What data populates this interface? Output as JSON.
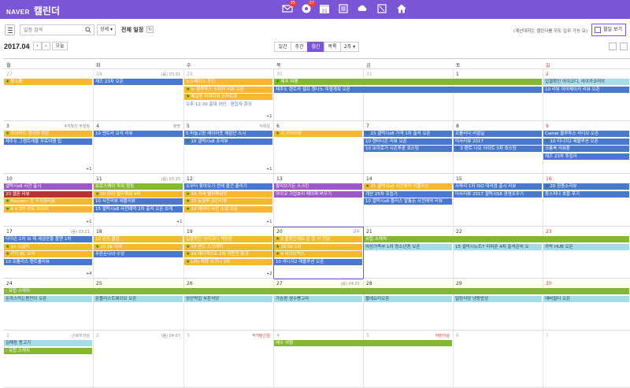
{
  "header": {
    "brand": "NAVER",
    "title": "캘린더",
    "icons": [
      {
        "name": "mail-icon",
        "badge": "25"
      },
      {
        "name": "talk-icon",
        "badge": "27"
      },
      {
        "name": "calendar-icon",
        "badge": "31"
      },
      {
        "name": "contacts-icon"
      },
      {
        "name": "cloud-icon"
      },
      {
        "name": "memo-icon"
      },
      {
        "name": "home-icon"
      }
    ]
  },
  "toolbar": {
    "search_placeholder": "일정 검색",
    "detail_label": "상세 ▾",
    "all_label": "전체 일정",
    "refresh_icon": "↻",
    "notice": "(계산대하는 캘린더를 자도 입무 가능 요)",
    "monthly_label": "월일 보기"
  },
  "nav": {
    "month": "2017.04",
    "prev": "‹",
    "next": "›",
    "today": "오늘",
    "view_tabs": [
      "일간",
      "주간",
      "월간",
      "목록",
      "2주 ▾"
    ],
    "active_view": "월간"
  },
  "weekdays": [
    "월",
    "화",
    "수",
    "목",
    "금",
    "토",
    "일"
  ],
  "weeks": [
    {
      "days": [
        {
          "num": "27",
          "muted": true
        },
        {
          "num": "28",
          "muted": true,
          "label": "(음) 03.01"
        },
        {
          "num": "29",
          "muted": true
        },
        {
          "num": "30",
          "muted": true
        },
        {
          "num": "31",
          "muted": true
        },
        {
          "num": "1"
        },
        {
          "num": "2",
          "sun": true
        }
      ],
      "events": [
        {
          "col": 0,
          "span": 1,
          "row": 0,
          "color": "y",
          "star": true,
          "text": "봄소풍"
        },
        {
          "col": 1,
          "span": 1,
          "row": 0,
          "color": "b",
          "text": "재즈 23차 오픈"
        },
        {
          "col": 2,
          "span": 1,
          "row": 0,
          "color": "y",
          "text": "노스페이스 조인"
        },
        {
          "col": 3,
          "span": 3,
          "row": 0,
          "color": "g",
          "star": true,
          "text": "제주 여행"
        },
        {
          "col": 6,
          "span": 1,
          "row": 0,
          "color": "c",
          "text": "입결확인 아이코디, 라이카코리아"
        },
        {
          "col": 2,
          "span": 1,
          "row": 1,
          "color": "y",
          "star": true,
          "text": "뉴 블루투스 스피커 리뷰 오픈"
        },
        {
          "col": 3,
          "span": 3,
          "row": 1,
          "color": "b",
          "text": "제주도 렌트카 셀프 렌나노 여행계획 오픈"
        },
        {
          "col": 6,
          "span": 1,
          "row": 1,
          "color": "b",
          "text": "10 리뷰 아이메이커 리뷰 오픈"
        },
        {
          "col": 2,
          "span": 1,
          "row": 2,
          "color": "y",
          "star": true,
          "text": "메일동 아이디어 스마트폰"
        },
        {
          "col": 2,
          "span": 1,
          "row": 3,
          "color": "text",
          "text": "오후 12:30 홍대 와인 · 편집자 회의"
        }
      ],
      "more": [
        {
          "col": 2,
          "text": "+1"
        }
      ]
    },
    {
      "days": [
        {
          "num": "3"
        },
        {
          "num": "4",
          "label": "청명"
        },
        {
          "num": "5",
          "label": "식목일"
        },
        {
          "num": "6"
        },
        {
          "num": "7"
        },
        {
          "num": "8"
        },
        {
          "num": "9",
          "sun": true
        }
      ],
      "day_labels_extra": [
        {
          "col": 0,
          "text": "4개월간 주설정"
        }
      ],
      "events": [
        {
          "col": 0,
          "span": 1,
          "row": 0,
          "color": "y",
          "star": true,
          "text": "하이마트 영상장 방문"
        },
        {
          "col": 1,
          "span": 1,
          "row": 0,
          "color": "b",
          "text": "10 엔트리 오리 리뷰"
        },
        {
          "col": 2,
          "span": 1,
          "row": 0,
          "color": "b",
          "text": "5 마늘고등 레이아웃 체험단 스시"
        },
        {
          "col": 3,
          "span": 1,
          "row": 0,
          "color": "y",
          "star": true,
          "text": "오 카이아몬"
        },
        {
          "col": 4,
          "span": 1,
          "row": 0,
          "color": "b",
          "star": true,
          "text": "15 갤럭시s8 가격 1차 출석 오픈"
        },
        {
          "col": 5,
          "span": 1,
          "row": 0,
          "color": "b",
          "text": "프롤리다 리얼딜"
        },
        {
          "col": 6,
          "span": 1,
          "row": 0,
          "color": "b",
          "text": "Camel 블루투스 라디오 오픈"
        },
        {
          "col": 0,
          "span": 1,
          "row": 1,
          "color": "b",
          "text": "제주도 그램트래블 무료여행 팁"
        },
        {
          "col": 2,
          "span": 1,
          "row": 1,
          "color": "b",
          "star": true,
          "text": "10 갤럭시s8 조리뷰"
        },
        {
          "col": 4,
          "span": 1,
          "row": 1,
          "color": "b",
          "text": "10 렌터나은 리뷰 오픈"
        },
        {
          "col": 5,
          "span": 1,
          "row": 1,
          "color": "b",
          "text": "미사리뷰 2017"
        },
        {
          "col": 6,
          "span": 1,
          "row": 1,
          "color": "b",
          "star": true,
          "text": "10 리니지2 레볼루션 오픈"
        },
        {
          "col": 4,
          "span": 1,
          "row": 2,
          "color": "b",
          "text": "10 보이로거 시즌투중 호스팅"
        },
        {
          "col": 5,
          "span": 1,
          "row": 2,
          "color": "b",
          "star": true,
          "text": "3 렌트 나오 사이트 3차 호스팅"
        },
        {
          "col": 6,
          "span": 1,
          "row": 2,
          "color": "b",
          "text": "크롬북 리뷰툰"
        },
        {
          "col": 6,
          "span": 1,
          "row": 3,
          "color": "b",
          "text": "재즈 23차 휴집리"
        }
      ],
      "more": [
        {
          "col": 0,
          "text": "+1"
        },
        {
          "col": 2,
          "text": "+1"
        }
      ]
    },
    {
      "days": [
        {
          "num": "10"
        },
        {
          "num": "11",
          "label": "(음) 03.15"
        },
        {
          "num": "12"
        },
        {
          "num": "13"
        },
        {
          "num": "14"
        },
        {
          "num": "15"
        },
        {
          "num": "16",
          "sun": true
        }
      ],
      "events": [
        {
          "col": 0,
          "span": 1,
          "row": 0,
          "color": "p",
          "text": "갤럭시s8 사전 출시"
        },
        {
          "col": 1,
          "span": 1,
          "row": 0,
          "color": "g",
          "text": "유로스퀘어 파워 캠핑"
        },
        {
          "col": 2,
          "span": 1,
          "row": 0,
          "color": "b",
          "text": "소무터 찾아오기 전에 물건 흘리기"
        },
        {
          "col": 3,
          "span": 1,
          "row": 0,
          "color": "p",
          "text": "할리브가든 스크린"
        },
        {
          "col": 4,
          "span": 1,
          "row": 0,
          "color": "y",
          "star": true,
          "text": "15 갤럭시s8 사전예약 어플리스"
        },
        {
          "col": 5,
          "span": 1,
          "row": 0,
          "color": "b",
          "text": "사파리 1차 ISO 대리점 출시 리뷰"
        },
        {
          "col": 6,
          "span": 1,
          "row": 0,
          "color": "b",
          "star": true,
          "text": "20 정품소리뷰"
        },
        {
          "col": 0,
          "span": 1,
          "row": 1,
          "color": "r",
          "text": "20 셀폰 리뷰"
        },
        {
          "col": 1,
          "span": 1,
          "row": 1,
          "color": "y",
          "star": true,
          "text": "30 아티 컬러파워 4리"
        },
        {
          "col": 2,
          "span": 1,
          "row": 1,
          "color": "y",
          "star": true,
          "text": "10 가래 웰피파워킷"
        },
        {
          "col": 3,
          "span": 1,
          "row": 1,
          "color": "p",
          "text": "아이코 기업호리 페이퍼 바우기"
        },
        {
          "col": 4,
          "span": 1,
          "row": 1,
          "color": "b",
          "text": "계산 25차 조립기"
        },
        {
          "col": 5,
          "span": 1,
          "row": 1,
          "color": "b",
          "text": "미사리뷰 2017 갤럭시S8 경영조주기"
        },
        {
          "col": 6,
          "span": 1,
          "row": 1,
          "color": "b",
          "text": "동스피나 호황 후기"
        },
        {
          "col": 0,
          "span": 1,
          "row": 2,
          "color": "y",
          "star": true,
          "text": "Foxconn 창 주최종리뷰"
        },
        {
          "col": 1,
          "span": 1,
          "row": 2,
          "color": "b",
          "text": "10 사전리뷰 애플리뷰"
        },
        {
          "col": 2,
          "span": 1,
          "row": 2,
          "color": "y",
          "star": true,
          "text": "10 듀랄루 조인리뷰"
        },
        {
          "col": 4,
          "span": 1,
          "row": 2,
          "color": "b",
          "text": "10 갤럭시s8 플러스 발통돈 사전예약 리뷰"
        },
        {
          "col": 0,
          "span": 1,
          "row": 3,
          "color": "y",
          "star": true,
          "text": "8 4 3차 리모 보이저"
        },
        {
          "col": 1,
          "span": 1,
          "row": 3,
          "color": "b",
          "text": "15 갤럭시s8 사전예약 2차 출석 오픈 보게"
        },
        {
          "col": 2,
          "span": 1,
          "row": 3,
          "color": "y",
          "star": true,
          "text": "10 에이다 사전 소셜 오픈"
        }
      ],
      "more": [
        {
          "col": 0,
          "text": "+1"
        },
        {
          "col": 1,
          "text": "+1"
        },
        {
          "col": 2,
          "text": "+1"
        }
      ]
    },
    {
      "days": [
        {
          "num": "17",
          "label": "(음) 03.21"
        },
        {
          "num": "18"
        },
        {
          "num": "19"
        },
        {
          "num": "20",
          "label": "곡우",
          "selected": true
        },
        {
          "num": "21"
        },
        {
          "num": "22"
        },
        {
          "num": "23",
          "sun": true
        }
      ],
      "events": [
        {
          "col": 0,
          "span": 1,
          "row": 0,
          "color": "b",
          "text": "다이슨 1차 SI 제 세금얻을 플랜 1차"
        },
        {
          "col": 1,
          "span": 1,
          "row": 0,
          "color": "y",
          "text": "10 된지 졸업"
        },
        {
          "col": 2,
          "span": 1,
          "row": 0,
          "color": "y",
          "text": "입결확인 아이코디 액정판"
        },
        {
          "col": 3,
          "span": 1,
          "row": 0,
          "color": "y",
          "star": true,
          "text": "8 볼류킨에요 준 일 리 전달"
        },
        {
          "col": 4,
          "span": 4,
          "row": 0,
          "color": "g",
          "text": "유럽 스케치"
        },
        {
          "col": 0,
          "span": 1,
          "row": 1,
          "color": "y",
          "star": true,
          "text": "10 사셜리"
        },
        {
          "col": 1,
          "span": 1,
          "row": 1,
          "color": "y",
          "star": true,
          "text": "20 SK 타리"
        },
        {
          "col": 2,
          "span": 1,
          "row": 1,
          "color": "y",
          "star": true,
          "text": "10 센트 스크래치"
        },
        {
          "col": 3,
          "span": 1,
          "row": 1,
          "color": "y",
          "star": true,
          "text": "10 SK 1차"
        },
        {
          "col": 4,
          "span": 1,
          "row": 1,
          "color": "c",
          "text": "여성가족부 1차 청소년증 오픈"
        },
        {
          "col": 5,
          "span": 1,
          "row": 1,
          "color": "c",
          "text": "15 갤럭시노트7 리퍼폰 4차 출석준비 오"
        },
        {
          "col": 6,
          "span": 1,
          "row": 1,
          "color": "c",
          "text": "카박 HUB 오픈"
        },
        {
          "col": 0,
          "span": 1,
          "row": 2,
          "color": "y",
          "star": true,
          "text": "카카 RC 오리"
        },
        {
          "col": 1,
          "span": 1,
          "row": 2,
          "color": "b",
          "text": "푸른돈다녀 수당"
        },
        {
          "col": 2,
          "span": 1,
          "row": 2,
          "color": "y",
          "star": true,
          "text": "10 에디엑스프 2차 어떤증 통과"
        },
        {
          "col": 3,
          "span": 1,
          "row": 2,
          "color": "y",
          "star": true,
          "text": "8 라이브백스"
        },
        {
          "col": 0,
          "span": 1,
          "row": 3,
          "color": "b",
          "text": "10 프롤리스 렌트룰리뷰"
        },
        {
          "col": 2,
          "span": 1,
          "row": 3,
          "color": "y",
          "star": true,
          "text": "LPG 차량 시크니 3차"
        },
        {
          "col": 3,
          "span": 1,
          "row": 3,
          "color": "b",
          "text": "10 리니지2 레볼루션 오픈"
        }
      ],
      "more": [
        {
          "col": 0,
          "text": "+4"
        },
        {
          "col": 2,
          "text": "+2"
        }
      ]
    },
    {
      "days": [
        {
          "num": "24"
        },
        {
          "num": "25"
        },
        {
          "num": "26"
        },
        {
          "num": "27",
          "label": "(음) 04.01"
        },
        {
          "num": "28"
        },
        {
          "num": "29"
        },
        {
          "num": "30",
          "sun": true
        }
      ],
      "events": [
        {
          "col": 0,
          "span": 7,
          "row": 0,
          "color": "g",
          "text": "‹ 유럽 스케치"
        },
        {
          "col": 0,
          "span": 1,
          "row": 1,
          "color": "c",
          "text": "돈까스먹는봄만이 오픈"
        },
        {
          "col": 1,
          "span": 1,
          "row": 1,
          "color": "c",
          "text": "몬플러스트웨이브 오픈"
        },
        {
          "col": 2,
          "span": 1,
          "row": 1,
          "color": "c",
          "text": "성산락업 부흔석당"
        },
        {
          "col": 3,
          "span": 1,
          "row": 1,
          "color": "c",
          "text": "가슴편 생수빵고라"
        },
        {
          "col": 4,
          "span": 1,
          "row": 1,
          "color": "c",
          "text": "물에요리오픈"
        },
        {
          "col": 5,
          "span": 1,
          "row": 1,
          "color": "c",
          "text": "밀링식당 냉동밥상"
        },
        {
          "col": 6,
          "span": 1,
          "row": 1,
          "color": "c",
          "text": "에버필터 오픈"
        }
      ],
      "more": []
    },
    {
      "days": [
        {
          "num": "1",
          "muted": true,
          "label": "근로자의날"
        },
        {
          "num": "2",
          "muted": true,
          "label": "(음) 04.07"
        },
        {
          "num": "3",
          "muted": true,
          "label": "석가탄신일",
          "label_red": true
        },
        {
          "num": "4",
          "muted": true
        },
        {
          "num": "5",
          "muted": true,
          "label": "어린이날",
          "label_red": true
        },
        {
          "num": "6",
          "muted": true
        },
        {
          "num": "7",
          "muted": true,
          "sun": true
        }
      ],
      "events": [
        {
          "col": 0,
          "span": 1,
          "row": 0,
          "color": "c",
          "text": "김해동 몽고기"
        },
        {
          "col": 3,
          "span": 2,
          "row": 0,
          "color": "g",
          "text": "예수 여행"
        },
        {
          "col": 0,
          "span": 1,
          "row": 1,
          "color": "g",
          "text": "› 유럽 스케치"
        }
      ],
      "more": []
    }
  ]
}
